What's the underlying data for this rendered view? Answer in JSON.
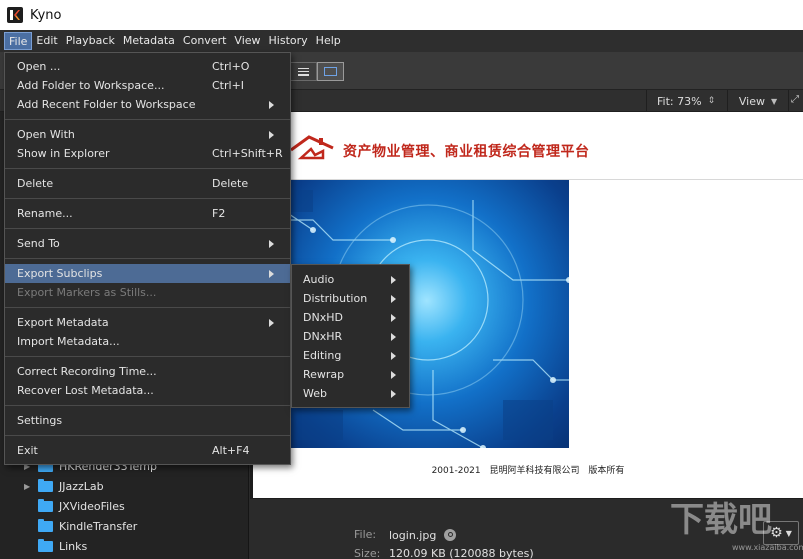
{
  "app": {
    "title": "Kyno",
    "icon": "kyno-logo-icon"
  },
  "menubar": [
    "File",
    "Edit",
    "Playback",
    "Metadata",
    "Convert",
    "View",
    "History",
    "Help"
  ],
  "menubar_active": "File",
  "preview": {
    "fit_label": "Fit: 73%",
    "view_label": "View",
    "doc_title": "资产物业管理、商业租赁综合管理平台",
    "footer_years": "2001-2021",
    "footer_company": "昆明阿羊科技有限公司",
    "footer_rights": "版本所有"
  },
  "sidebar": {
    "items": [
      {
        "label": "HKRender33Temp",
        "expandable": true
      },
      {
        "label": "JJazzLab",
        "expandable": true
      },
      {
        "label": "JXVideoFiles",
        "expandable": false
      },
      {
        "label": "KindleTransfer",
        "expandable": false
      },
      {
        "label": "Links",
        "expandable": false
      }
    ]
  },
  "info": {
    "file_key": "File:",
    "file_value": "login.jpg",
    "size_key": "Size:",
    "size_value": "120.09 KB (120088 bytes)"
  },
  "watermark": {
    "text": "下载吧",
    "url": "www.xiazaiba.com"
  },
  "file_menu": {
    "open": {
      "label": "Open ...",
      "shortcut": "Ctrl+O"
    },
    "add_folder": {
      "label": "Add Folder to Workspace...",
      "shortcut": "Ctrl+I"
    },
    "add_recent": {
      "label": "Add Recent Folder to Workspace"
    },
    "open_with": {
      "label": "Open With"
    },
    "show_explorer": {
      "label": "Show in Explorer",
      "shortcut": "Ctrl+Shift+R"
    },
    "delete": {
      "label": "Delete",
      "shortcut": "Delete"
    },
    "rename": {
      "label": "Rename...",
      "shortcut": "F2"
    },
    "send_to": {
      "label": "Send To"
    },
    "export_subclips": {
      "label": "Export Subclips"
    },
    "export_markers": {
      "label": "Export Markers as Stills..."
    },
    "export_metadata": {
      "label": "Export Metadata"
    },
    "import_metadata": {
      "label": "Import Metadata..."
    },
    "correct_time": {
      "label": "Correct Recording Time..."
    },
    "recover_metadata": {
      "label": "Recover Lost Metadata..."
    },
    "settings": {
      "label": "Settings"
    },
    "exit": {
      "label": "Exit",
      "shortcut": "Alt+F4"
    }
  },
  "export_submenu": [
    "Audio",
    "Distribution",
    "DNxHD",
    "DNxHR",
    "Editing",
    "Rewrap",
    "Web"
  ]
}
